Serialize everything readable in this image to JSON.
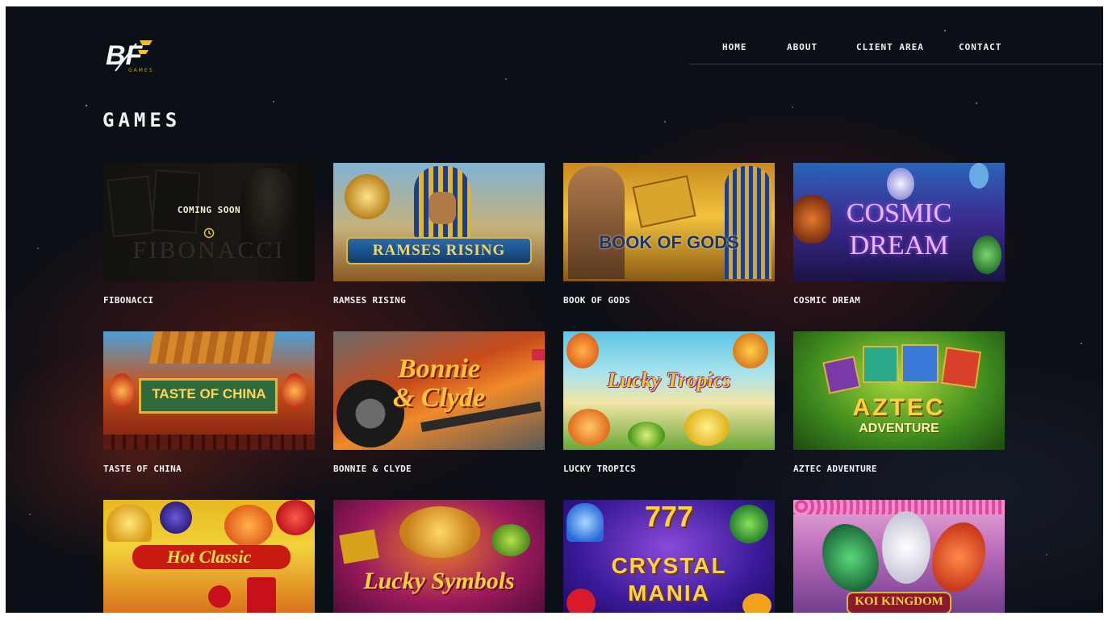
{
  "brand": {
    "logo_text": "BF",
    "logo_subtext": "GAMES"
  },
  "nav": {
    "items": [
      "HOME",
      "ABOUT",
      "CLIENT AREA",
      "CONTACT"
    ]
  },
  "page": {
    "title": "GAMES"
  },
  "games": [
    {
      "name": "FIBONACCI",
      "logo": "FIBONACCI",
      "status": "COMING SOON",
      "clock_icon": "clock-icon"
    },
    {
      "name": "RAMSES RISING",
      "logo": "RAMSES RISING"
    },
    {
      "name": "BOOK OF GODS",
      "logo": "BOOK OF GODS"
    },
    {
      "name": "COSMIC DREAM",
      "logo_line1": "COSMIC",
      "logo_line2": "DREAM"
    },
    {
      "name": "TASTE OF CHINA",
      "logo": "TASTE OF CHINA"
    },
    {
      "name": "BONNIE & CLYDE",
      "logo_line1": "Bonnie",
      "logo_line2": "& Clyde"
    },
    {
      "name": "LUCKY TROPICS",
      "logo": "Lucky Tropics"
    },
    {
      "name": "AZTEC ADVENTURE",
      "logo_line1": "AZTEC",
      "logo_line2": "ADVENTURE"
    },
    {
      "name": "HOT CLASSIC",
      "logo": "Hot Classic"
    },
    {
      "name": "LUCKY SYMBOLS",
      "logo": "Lucky Symbols"
    },
    {
      "name": "CRYSTAL MANIA",
      "logo_top": "777",
      "logo_line1": "CRYSTAL",
      "logo_line2": "MANIA"
    },
    {
      "name": "KOI KINGDOM",
      "logo": "KOI KINGDOM"
    }
  ],
  "colors": {
    "background": "#0b0f16",
    "text": "#f3f3f3",
    "logo_accent": "#f2c21a"
  }
}
